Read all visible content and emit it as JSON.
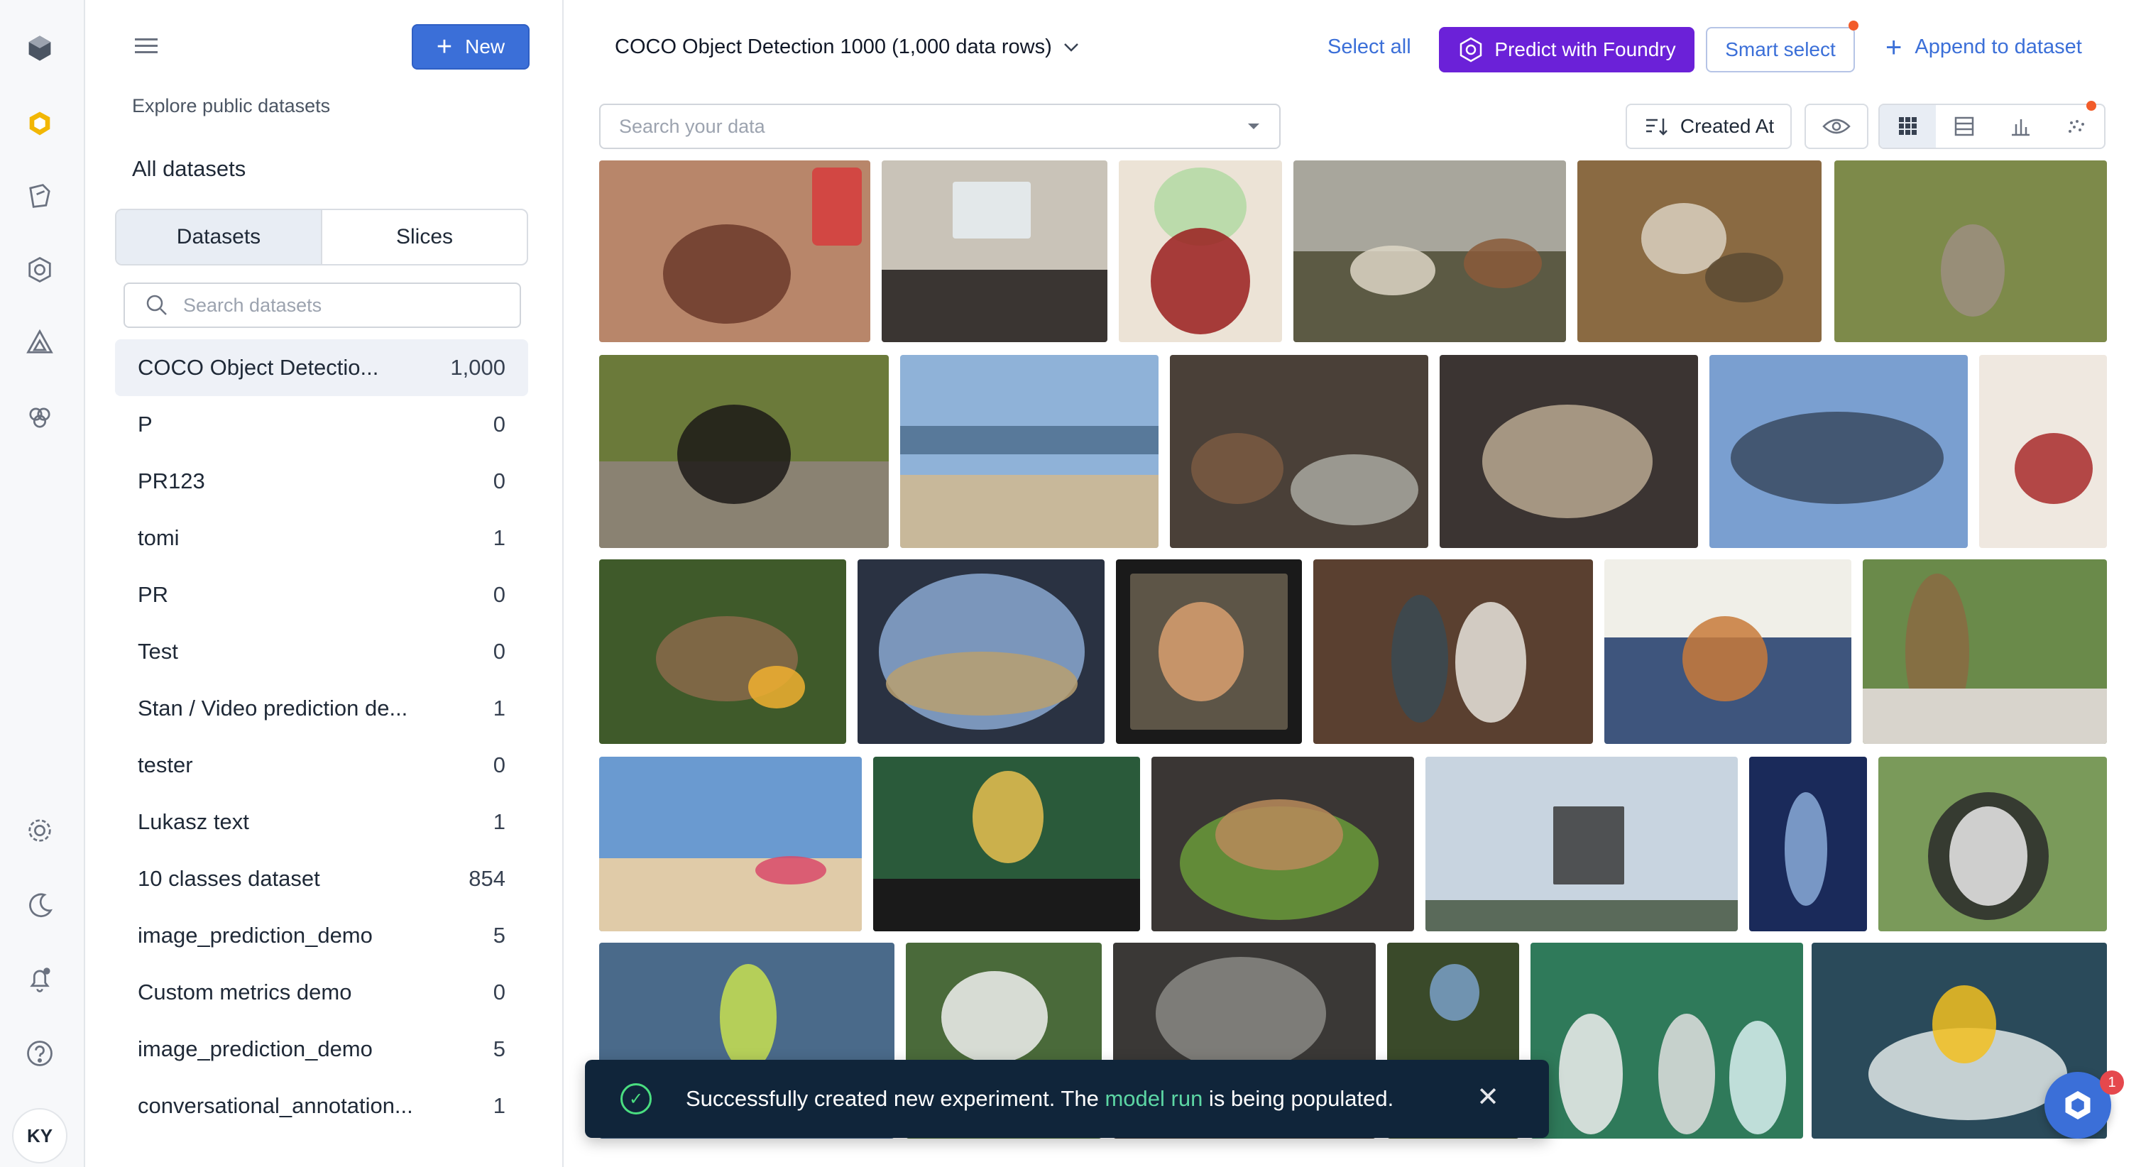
{
  "user": {
    "initials": "KY"
  },
  "sidebar": {
    "new_label": "New",
    "explore_label": "Explore public datasets",
    "all_datasets_label": "All datasets",
    "tabs": [
      "Datasets",
      "Slices"
    ],
    "search_placeholder": "Search datasets",
    "items": [
      {
        "name": "COCO Object Detectio...",
        "count": "1,000"
      },
      {
        "name": "P",
        "count": "0"
      },
      {
        "name": "PR123",
        "count": "0"
      },
      {
        "name": "tomi",
        "count": "1"
      },
      {
        "name": "PR",
        "count": "0"
      },
      {
        "name": "Test",
        "count": "0"
      },
      {
        "name": "Stan / Video prediction de...",
        "count": "1"
      },
      {
        "name": "tester",
        "count": "0"
      },
      {
        "name": "Lukasz text",
        "count": "1"
      },
      {
        "name": "10 classes dataset",
        "count": "854"
      },
      {
        "name": "image_prediction_demo",
        "count": "5"
      },
      {
        "name": "Custom metrics demo",
        "count": "0"
      },
      {
        "name": "image_prediction_demo",
        "count": "5"
      },
      {
        "name": "conversational_annotation...",
        "count": "1"
      }
    ]
  },
  "header": {
    "dataset_title": "COCO Object Detection 1000 (1,000 data rows)",
    "select_all": "Select all",
    "predict": "Predict with Foundry",
    "smart_select": "Smart select",
    "append": "Append to dataset"
  },
  "toolbar": {
    "search_placeholder": "Search your data",
    "sort_label": "Created At"
  },
  "toast": {
    "text_before": "Successfully created new experiment. The ",
    "link": "model run",
    "text_after": " is being populated."
  },
  "help": {
    "badge_count": "1"
  },
  "colors": {
    "accent": "#3b6fd8",
    "foundry": "#6b21d8",
    "toast_bg": "#10253a",
    "notification": "#f25c2a"
  }
}
